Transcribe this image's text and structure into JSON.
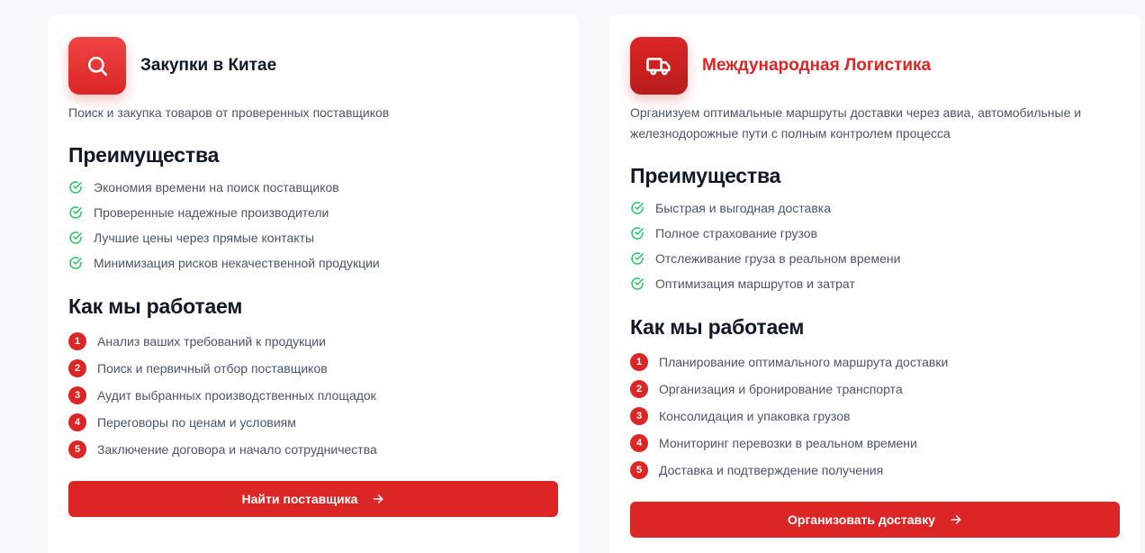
{
  "cards": [
    {
      "icon": "search-icon",
      "title": "Закупки в Китае",
      "description": "Поиск и закупка товаров от проверенных поставщиков",
      "advantages_title": "Преимущества",
      "advantages": [
        "Экономия времени на поиск поставщиков",
        "Проверенные надежные производители",
        "Лучшие цены через прямые контакты",
        "Минимизация рисков некачественной продукции"
      ],
      "process_title": "Как мы работаем",
      "steps": [
        {
          "num": "1",
          "text": "Анализ ваших требований к продукции"
        },
        {
          "num": "2",
          "text": "Поиск и первичный отбор поставщиков"
        },
        {
          "num": "3",
          "text": "Аудит выбранных производственных площадок"
        },
        {
          "num": "4",
          "text": "Переговоры по ценам и условиям"
        },
        {
          "num": "5",
          "text": "Заключение договора и начало сотрудничества"
        }
      ],
      "button_label": "Найти поставщика"
    },
    {
      "icon": "truck-icon",
      "title": "Международная Логистика",
      "description": "Организуем оптимальные маршруты доставки через авиа, автомобильные и железнодорожные пути с полным контролем процесса",
      "advantages_title": "Преимущества",
      "advantages": [
        "Быстрая и выгодная доставка",
        "Полное страхование грузов",
        "Отслеживание груза в реальном времени",
        "Оптимизация маршрутов и затрат"
      ],
      "process_title": "Как мы работаем",
      "steps": [
        {
          "num": "1",
          "text": "Планирование оптимального маршрута доставки"
        },
        {
          "num": "2",
          "text": "Организация и бронирование транспорта"
        },
        {
          "num": "3",
          "text": "Консолидация и упаковка грузов"
        },
        {
          "num": "4",
          "text": "Мониторинг перевозки в реальном времени"
        },
        {
          "num": "5",
          "text": "Доставка и подтверждение получения"
        }
      ],
      "button_label": "Организовать доставку"
    }
  ],
  "colors": {
    "accent": "#dc2626",
    "check": "#22c55e",
    "text_muted": "#4b5563",
    "heading": "#111827",
    "background": "#f7f8fa"
  }
}
